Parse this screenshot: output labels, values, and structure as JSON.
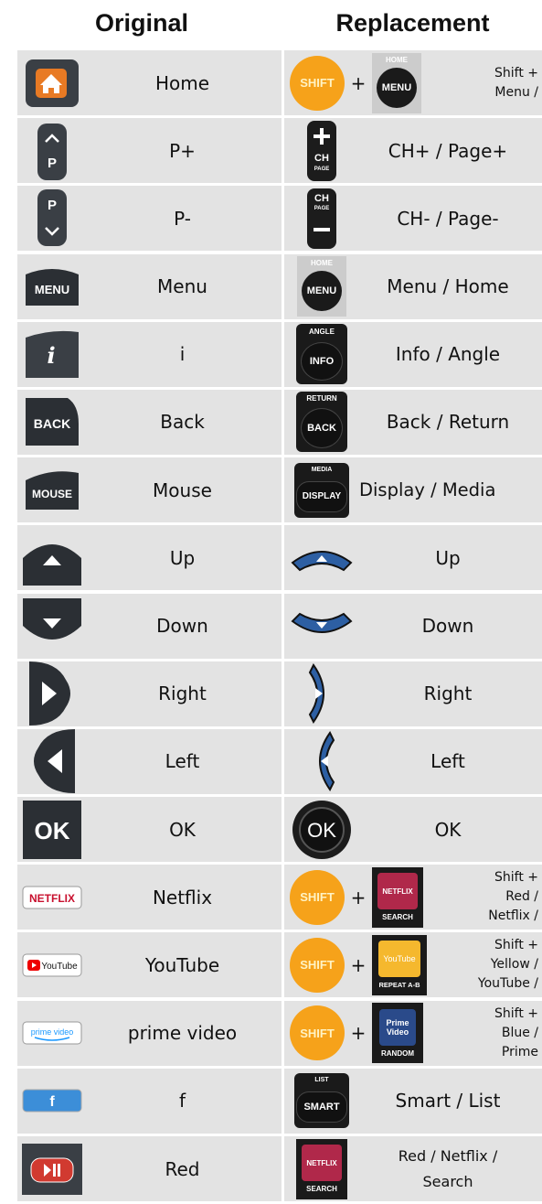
{
  "header": {
    "original": "Original",
    "replacement": "Replacement"
  },
  "rows": [
    {
      "original": "Home",
      "replacement": [
        "Shift +",
        "Menu /"
      ],
      "orig_icon": "home-icon",
      "repl_icon": [
        "shift-button",
        "menu-home-button"
      ]
    },
    {
      "original": "P+",
      "replacement": "CH+ / Page+",
      "orig_icon": "p-plus-icon",
      "repl_icon": [
        "ch-page-plus-button"
      ]
    },
    {
      "original": "P-",
      "replacement": "CH- / Page-",
      "orig_icon": "p-minus-icon",
      "repl_icon": [
        "ch-page-minus-button"
      ]
    },
    {
      "original": "Menu",
      "replacement": "Menu / Home",
      "orig_icon": "menu-icon",
      "repl_icon": [
        "menu-home-button"
      ]
    },
    {
      "original": "i",
      "replacement": "Info / Angle",
      "orig_icon": "info-icon",
      "repl_icon": [
        "info-angle-button"
      ]
    },
    {
      "original": "Back",
      "replacement": "Back / Return",
      "orig_icon": "back-icon",
      "repl_icon": [
        "back-return-button"
      ]
    },
    {
      "original": "Mouse",
      "replacement": "Display / Media",
      "orig_icon": "mouse-icon",
      "repl_icon": [
        "display-media-button"
      ]
    },
    {
      "original": "Up",
      "replacement": "Up",
      "orig_icon": "up-arrow-icon",
      "repl_icon": [
        "up-arrow-button"
      ]
    },
    {
      "original": "Down",
      "replacement": "Down",
      "orig_icon": "down-arrow-icon",
      "repl_icon": [
        "down-arrow-button"
      ]
    },
    {
      "original": "Right",
      "replacement": "Right",
      "orig_icon": "right-arrow-icon",
      "repl_icon": [
        "right-arrow-button"
      ]
    },
    {
      "original": "Left",
      "replacement": "Left",
      "orig_icon": "left-arrow-icon",
      "repl_icon": [
        "left-arrow-button"
      ]
    },
    {
      "original": "OK",
      "replacement": "OK",
      "orig_icon": "ok-icon",
      "repl_icon": [
        "ok-button"
      ]
    },
    {
      "original": "Netflix",
      "replacement": [
        "Shift +",
        "Red /",
        "Netflix /"
      ],
      "orig_icon": "netflix-icon",
      "repl_icon": [
        "shift-button",
        "netflix-search-button"
      ]
    },
    {
      "original": "YouTube",
      "replacement": [
        "Shift +",
        "Yellow /",
        "YouTube /"
      ],
      "orig_icon": "youtube-icon",
      "repl_icon": [
        "shift-button",
        "youtube-repeat-button"
      ]
    },
    {
      "original": "prime video",
      "replacement": [
        "Shift +",
        "Blue /",
        "Prime"
      ],
      "orig_icon": "prime-video-icon",
      "repl_icon": [
        "shift-button",
        "prime-random-button"
      ]
    },
    {
      "original": "f",
      "replacement": "Smart / List",
      "orig_icon": "facebook-icon",
      "repl_icon": [
        "smart-list-button"
      ]
    },
    {
      "original": "Red",
      "replacement": [
        "Red / Netflix /",
        "Search"
      ],
      "orig_icon": "red-play-icon",
      "repl_icon": [
        "netflix-search-button"
      ]
    }
  ],
  "button_text": {
    "shift": "SHIFT",
    "menu": "MENU",
    "home": "HOME",
    "ch": "CH",
    "page": "PAGE",
    "info": "INFO",
    "angle": "ANGLE",
    "back": "BACK",
    "return": "RETURN",
    "display": "DISPLAY",
    "media": "MEDIA",
    "ok": "OK",
    "netflix": "NETFLIX",
    "search": "SEARCH",
    "youtube": "YouTube",
    "repeat": "REPEAT A-B",
    "prime_video": "Prime Video",
    "random": "RANDOM",
    "smart": "SMART",
    "list": "LIST",
    "mouse": "MOUSE",
    "p": "P",
    "i": "i",
    "f": "f",
    "prime_logo": "prime video"
  },
  "colors": {
    "cell_bg": "#e3e3e3",
    "shift": "#f6a21a",
    "arrow_blue": "#2d5fa3",
    "netflix_red": "#c8102e",
    "youtube_yellow": "#f5b82e",
    "prime_blue": "#2a4a8a",
    "facebook_blue": "#3c8ed8"
  }
}
